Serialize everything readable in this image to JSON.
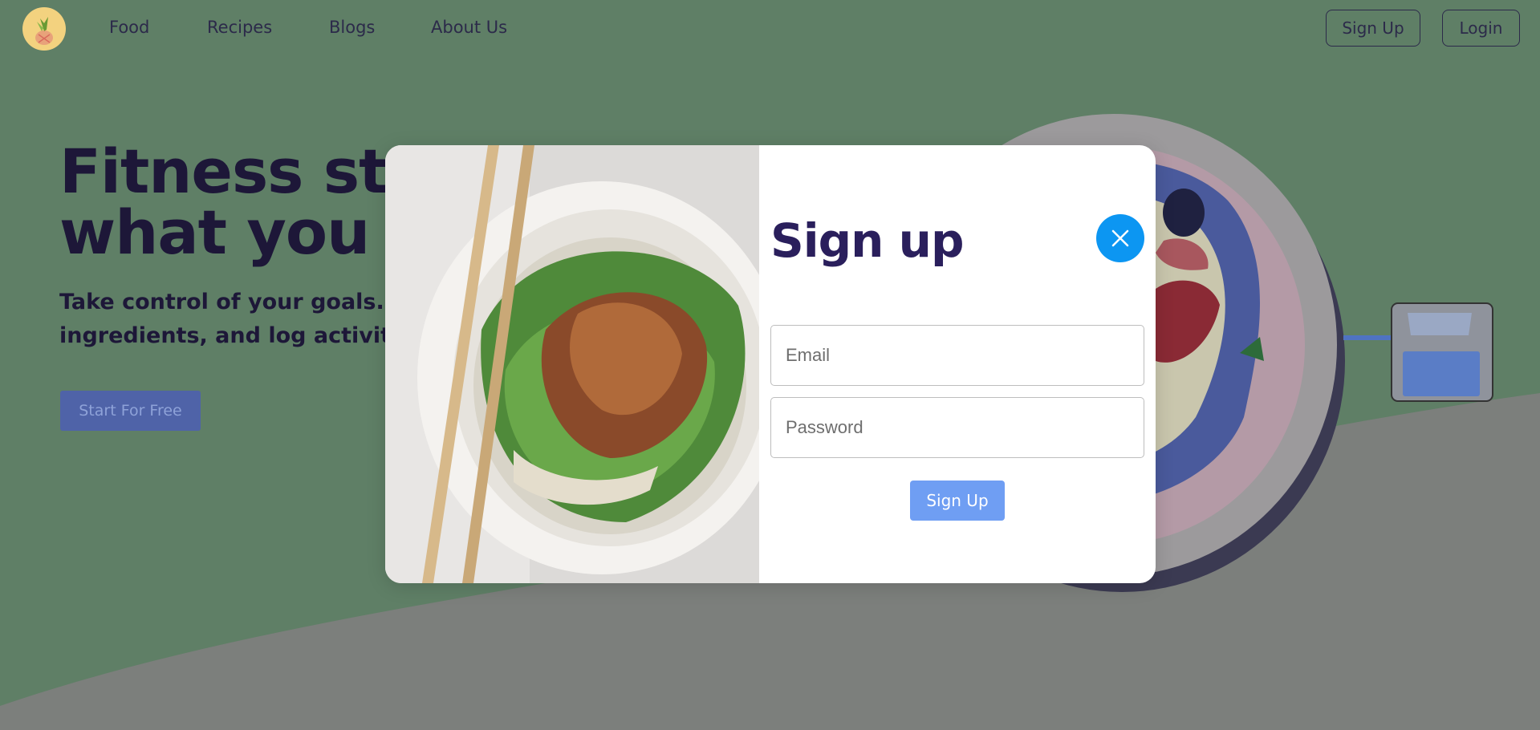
{
  "nav": {
    "links": [
      "Food",
      "Recipes",
      "Blogs",
      "About Us"
    ],
    "signup_label": "Sign Up",
    "login_label": "Login"
  },
  "hero": {
    "title_line1": "Fitness starts with",
    "title_line2": "what you eat.",
    "subtitle_line1": "Take control of your goals. Track calories, break down",
    "subtitle_line2": "ingredients, and log activities with MyFitnessPal.",
    "cta_label": "Start For Free"
  },
  "modal": {
    "title": "Sign up",
    "email_placeholder": "Email",
    "password_placeholder": "Password",
    "submit_label": "Sign Up"
  },
  "colors": {
    "background": "#5f7f66",
    "title": "#2a1f5c",
    "close_button": "#0c96f2",
    "submit_button": "#6f9ef3",
    "cta": "#4f63a8"
  },
  "icons": {
    "close": "close-icon",
    "logo": "pineapple-logo-icon"
  }
}
